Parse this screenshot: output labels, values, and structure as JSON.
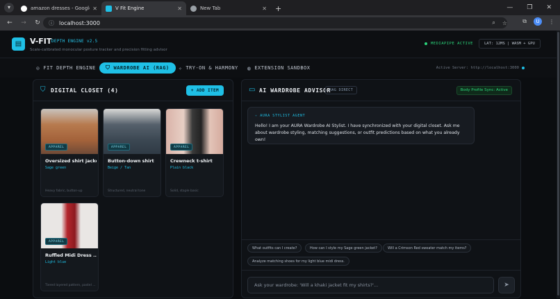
{
  "browser": {
    "tabs": [
      {
        "title": "amazon dresses - Google Sear",
        "color": "#ffffff"
      },
      {
        "title": "V Fit Engine",
        "color": "#1fc0e6"
      },
      {
        "title": "New Tab",
        "color": "#9aa0a6"
      }
    ],
    "url": "localhost:3000",
    "profile_initial": "U"
  },
  "app": {
    "brand": "V-FIT",
    "engine_version": "DEPTH ENGINE v2.5",
    "tagline": "Scale-calibrated monocular posture tracker and precision fitting advisor",
    "status": "MEDIAPIPE ACTIVE",
    "latency": "LAT: 12MS | WASM + GPU",
    "server": "Active Server: http://localhost:3000"
  },
  "nav": {
    "items": [
      {
        "label": "FIT DEPTH ENGINE",
        "icon": "crosshair-icon"
      },
      {
        "label": "WARDROBE AI (RAG)",
        "icon": "shirt-icon"
      },
      {
        "label": "TRY-ON & HARMONY",
        "icon": "sparkle-icon"
      },
      {
        "label": "EXTENSION SANDBOX",
        "icon": "globe-icon"
      }
    ],
    "active": "WARDROBE AI (RAG)"
  },
  "closet": {
    "title": "DIGITAL CLOSET (4)",
    "add_label": "+ ADD ITEM",
    "items": [
      {
        "category": "APPAREL",
        "name": "Oversized shirt jacket",
        "color": "Sage green",
        "desc": "Heavy fabric, button-up"
      },
      {
        "category": "APPAREL",
        "name": "Button-down shirt",
        "color": "Beige / Tan",
        "desc": "Structured, neutral tone"
      },
      {
        "category": "APPAREL",
        "name": "Crewneck t-shirt",
        "color": "Plain black",
        "desc": "Solid, staple basic"
      },
      {
        "category": "APPAREL",
        "name": "Ruffled Midi Dress ...",
        "color": "Light blue",
        "desc": "Tiered layered pattern, pastel ..."
      }
    ]
  },
  "advisor": {
    "title": "AI WARDROBE ADVISOR",
    "rag_badge": "RAG DIRECT",
    "sync_status": "Body Profile Sync: Active",
    "agent_label": "AURA STYLIST AGENT",
    "message": "Hello! I am your AURA Wardrobe AI Stylist. I have synchronized with your digital closet. Ask me about wardrobe styling, matching suggestions, or outfit predictions based on what you already own!",
    "suggestions": [
      "What outfits can I create?",
      "How can I style my Sage green jacket?",
      "Will a Crimson Red sweater match my items?",
      "Analyze matching shoes for my light blue midi dress."
    ],
    "input_placeholder": "Ask your wardrobe: 'Will a khaki jacket fit my shirts?'..."
  },
  "colors": {
    "accent": "#1fc0e6",
    "status": "#2bd67b",
    "background": "#0b0d10"
  }
}
